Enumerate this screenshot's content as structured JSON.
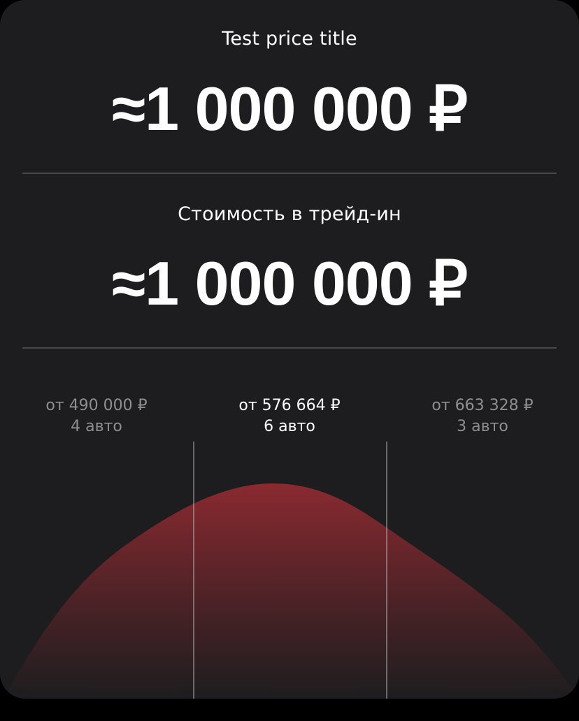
{
  "price": {
    "title": "Test price title",
    "value": "≈1 000 000 ₽"
  },
  "trade_in": {
    "title": "Стоимость в трейд-ин",
    "value": "≈1 000 000 ₽"
  },
  "distribution": {
    "buckets": [
      {
        "price_label": "от 490 000 ₽",
        "count_label": "4 авто",
        "active": false
      },
      {
        "price_label": "от 576 664 ₽",
        "count_label": "6 авто",
        "active": true
      },
      {
        "price_label": "от 663 328 ₽",
        "count_label": "3 авто",
        "active": false
      }
    ]
  },
  "colors": {
    "card_background": "#1d1d1f",
    "accent_red": "#8a2a30",
    "muted_text": "#8e8e93",
    "divider": "#48484b"
  }
}
